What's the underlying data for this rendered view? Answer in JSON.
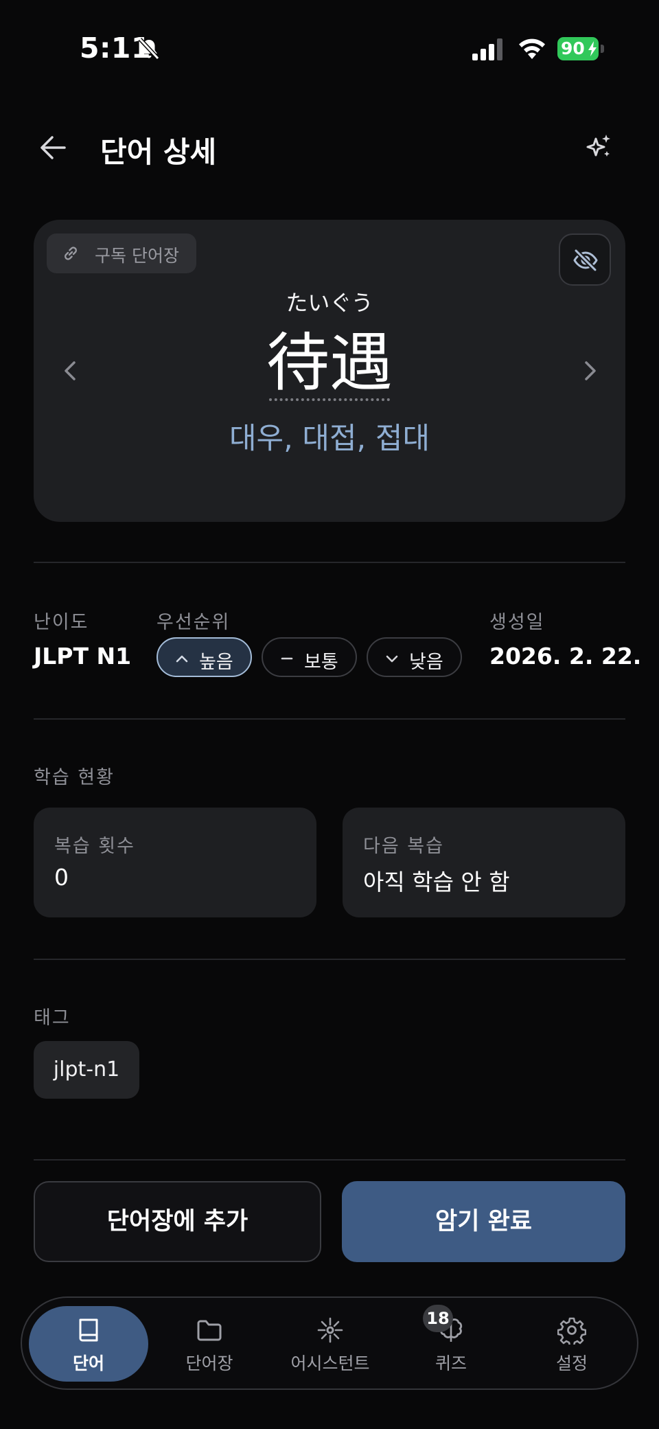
{
  "status_bar": {
    "time": "5:11",
    "battery": "90"
  },
  "header": {
    "title": "단어 상세"
  },
  "word_card": {
    "source_chip": "구독 단어장",
    "reading": "たいぐう",
    "word": "待遇",
    "meaning": "대우, 대접, 접대"
  },
  "info": {
    "difficulty_label": "난이도",
    "difficulty_value": "JLPT N1",
    "priority_label": "우선순위",
    "priority_options": [
      {
        "label": "높음",
        "icon": "chevron-up-icon",
        "selected": true
      },
      {
        "label": "보통",
        "icon": "minus-icon",
        "selected": false
      },
      {
        "label": "낮음",
        "icon": "chevron-down-icon",
        "selected": false
      }
    ],
    "created_label": "생성일",
    "created_value": "2026. 2. 22."
  },
  "study": {
    "section_label": "학습 현황",
    "review_count_label": "복습 횟수",
    "review_count_value": "0",
    "next_review_label": "다음 복습",
    "next_review_value": "아직 학습 안 함"
  },
  "tags": {
    "section_label": "태그",
    "items": [
      "jlpt-n1"
    ]
  },
  "actions": {
    "add_to_wordbook": "단어장에 추가",
    "mark_memorized": "암기 완료"
  },
  "bottom_nav": {
    "items": [
      {
        "label": "단어",
        "icon": "book-icon",
        "active": true
      },
      {
        "label": "단어장",
        "icon": "folder-icon",
        "active": false
      },
      {
        "label": "어시스턴트",
        "icon": "assistant-icon",
        "active": false
      },
      {
        "label": "퀴즈",
        "icon": "brain-icon",
        "active": false,
        "badge": "18"
      },
      {
        "label": "설정",
        "icon": "gear-icon",
        "active": false
      }
    ]
  },
  "colors": {
    "background": "#080809",
    "card": "#1e1f22",
    "accent": "#3e5b84",
    "meaning_text": "#8faed3",
    "battery_green": "#31c85a"
  }
}
